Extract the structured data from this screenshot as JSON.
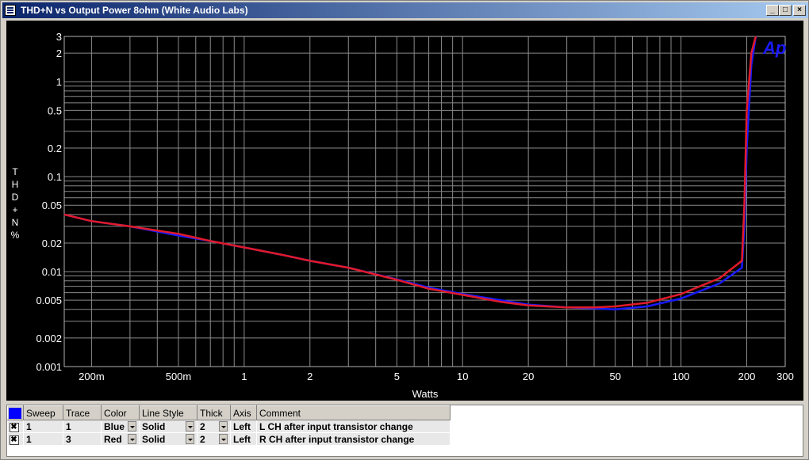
{
  "window": {
    "title": "THD+N vs Output Power 8ohm (White Audio Labs)"
  },
  "chart_data": {
    "type": "line",
    "title": "",
    "xlabel": "Watts",
    "ylabel": "THD+N %",
    "x_scale": "log",
    "y_scale": "log",
    "xlim": [
      0.15,
      300
    ],
    "ylim": [
      0.001,
      3
    ],
    "x_ticks": [
      {
        "v": 0.2,
        "label": "200m"
      },
      {
        "v": 0.5,
        "label": "500m"
      },
      {
        "v": 1,
        "label": "1"
      },
      {
        "v": 2,
        "label": "2"
      },
      {
        "v": 5,
        "label": "5"
      },
      {
        "v": 10,
        "label": "10"
      },
      {
        "v": 20,
        "label": "20"
      },
      {
        "v": 50,
        "label": "50"
      },
      {
        "v": 100,
        "label": "100"
      },
      {
        "v": 200,
        "label": "200"
      },
      {
        "v": 300,
        "label": "300"
      }
    ],
    "y_ticks": [
      {
        "v": 3,
        "label": "3"
      },
      {
        "v": 2,
        "label": "2"
      },
      {
        "v": 1,
        "label": "1"
      },
      {
        "v": 0.5,
        "label": "0.5"
      },
      {
        "v": 0.2,
        "label": "0.2"
      },
      {
        "v": 0.1,
        "label": "0.1"
      },
      {
        "v": 0.05,
        "label": "0.05"
      },
      {
        "v": 0.02,
        "label": "0.02"
      },
      {
        "v": 0.01,
        "label": "0.01"
      },
      {
        "v": 0.005,
        "label": "0.005"
      },
      {
        "v": 0.002,
        "label": "0.002"
      },
      {
        "v": 0.001,
        "label": "0.001"
      }
    ],
    "grid": true,
    "watermark": "Ap",
    "series": [
      {
        "name": "L CH after input transistor change",
        "color": "#1a1aff",
        "x": [
          0.15,
          0.2,
          0.3,
          0.5,
          0.7,
          1,
          1.5,
          2,
          3,
          5,
          7,
          10,
          15,
          20,
          30,
          40,
          50,
          70,
          100,
          150,
          190,
          195,
          200,
          210,
          220
        ],
        "y": [
          0.04,
          0.034,
          0.03,
          0.024,
          0.021,
          0.018,
          0.015,
          0.013,
          0.011,
          0.0083,
          0.0068,
          0.0058,
          0.005,
          0.0045,
          0.0042,
          0.0041,
          0.004,
          0.0043,
          0.0052,
          0.0075,
          0.011,
          0.03,
          0.2,
          1.5,
          3.0
        ]
      },
      {
        "name": "R CH after input transistor change",
        "color": "#e01a2a",
        "x": [
          0.15,
          0.2,
          0.3,
          0.5,
          0.7,
          1,
          1.5,
          2,
          3,
          5,
          7,
          10,
          15,
          20,
          30,
          40,
          50,
          70,
          100,
          150,
          190,
          195,
          200,
          210,
          220
        ],
        "y": [
          0.04,
          0.034,
          0.03,
          0.025,
          0.021,
          0.018,
          0.015,
          0.013,
          0.011,
          0.0082,
          0.0066,
          0.0057,
          0.0048,
          0.0044,
          0.0042,
          0.0042,
          0.0043,
          0.0047,
          0.0058,
          0.0085,
          0.013,
          0.05,
          0.5,
          2.0,
          3.0
        ]
      }
    ]
  },
  "table": {
    "headers": [
      "Sweep",
      "Trace",
      "Color",
      "Line Style",
      "Thick",
      "Axis",
      "Comment"
    ],
    "rows": [
      {
        "sweep": "1",
        "trace": "1",
        "color": "Blue",
        "line_style": "Solid",
        "thick": "2",
        "axis": "Left",
        "comment": "L CH after input transistor change"
      },
      {
        "sweep": "1",
        "trace": "3",
        "color": "Red",
        "line_style": "Solid",
        "thick": "2",
        "axis": "Left",
        "comment": "R CH after input transistor change"
      }
    ]
  }
}
